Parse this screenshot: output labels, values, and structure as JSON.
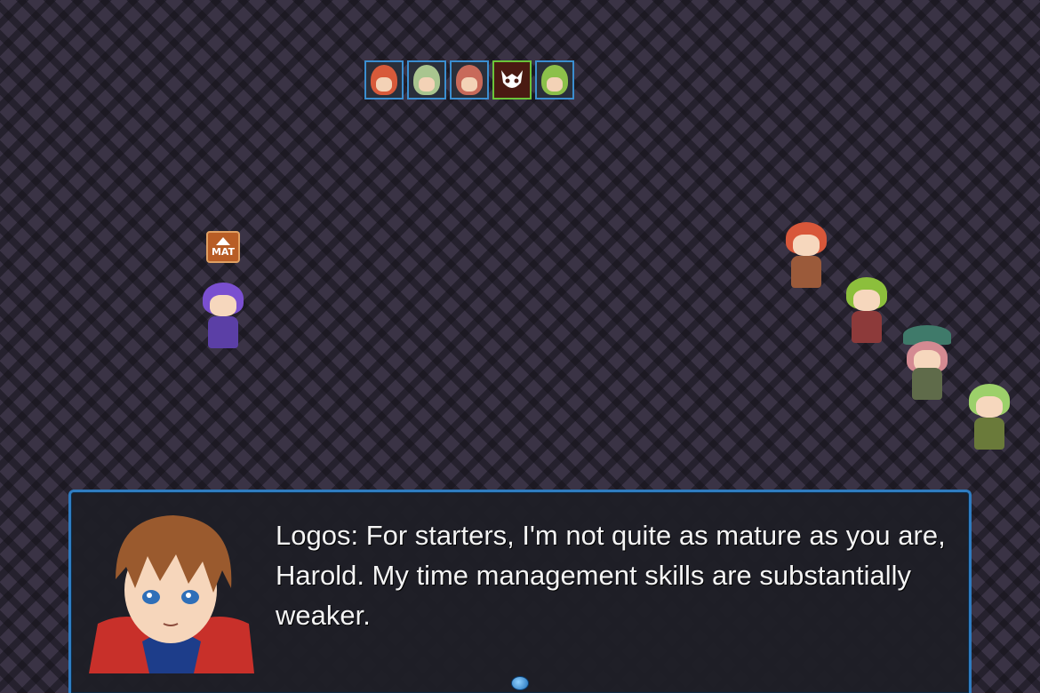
{
  "scene": {
    "background_color": "#3a3345",
    "accent_color": "#2f7cc0"
  },
  "turn_order": [
    {
      "name": "red-haired-hero-portrait-icon",
      "type": "ally",
      "hair": "#d85a3a"
    },
    {
      "name": "green-haired-knight-portrait-icon",
      "type": "ally",
      "hair": "#a9c58f"
    },
    {
      "name": "witch-portrait-icon",
      "type": "ally",
      "hair": "#c86a5a"
    },
    {
      "name": "enemy-skull-icon",
      "type": "enemy",
      "hair": "#ffffff"
    },
    {
      "name": "green-haired-archer-portrait-icon",
      "type": "ally",
      "hair": "#8cc04a"
    }
  ],
  "buff": {
    "label": "MAT",
    "icon": "up-arrow-icon"
  },
  "dialog": {
    "text": "Logos: For starters, I'm not quite as mature as you are, Harold. My time management skills are substantially weaker.",
    "speaker_portrait": "logos-portrait",
    "continue_icon": "continue-cursor-icon"
  }
}
